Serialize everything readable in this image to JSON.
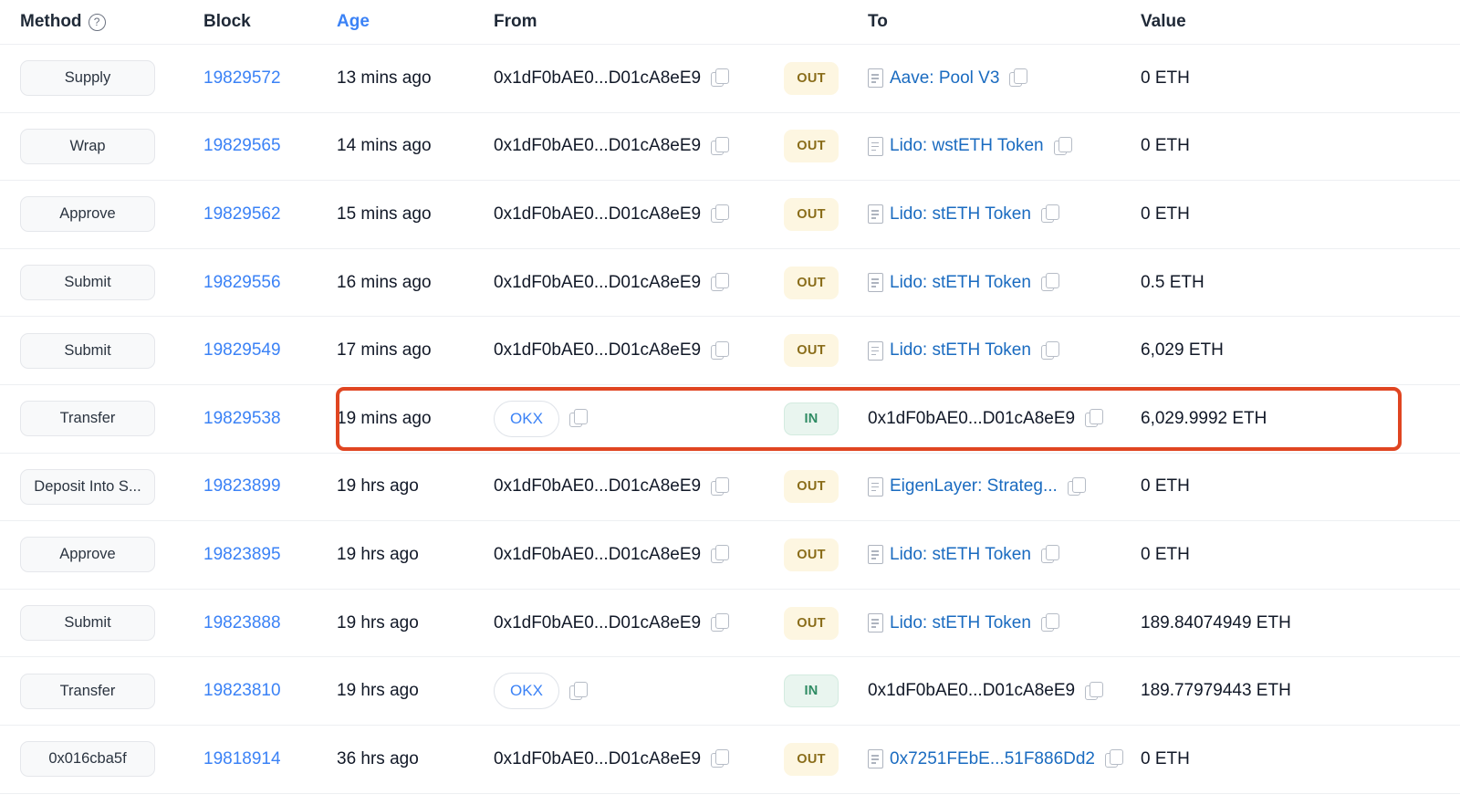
{
  "table": {
    "columns": [
      {
        "key": "method",
        "label": "Method",
        "has_help_icon": true,
        "sortable": false
      },
      {
        "key": "block",
        "label": "Block",
        "has_help_icon": false,
        "sortable": false
      },
      {
        "key": "age",
        "label": "Age",
        "has_help_icon": false,
        "sortable": true
      },
      {
        "key": "from",
        "label": "From",
        "has_help_icon": false,
        "sortable": false
      },
      {
        "key": "to",
        "label": "To",
        "has_help_icon": false,
        "sortable": false
      },
      {
        "key": "value",
        "label": "Value",
        "has_help_icon": false,
        "sortable": false
      }
    ],
    "rows": [
      {
        "method": "Supply",
        "block": "19829572",
        "age": "13 mins ago",
        "from": {
          "text": "0x1dF0bAE0...D01cA8eE9",
          "kind": "address",
          "copy": true
        },
        "direction": "OUT",
        "to": {
          "text": "Aave: Pool V3",
          "kind": "contract",
          "copy": true
        },
        "value": "0 ETH"
      },
      {
        "method": "Wrap",
        "block": "19829565",
        "age": "14 mins ago",
        "from": {
          "text": "0x1dF0bAE0...D01cA8eE9",
          "kind": "address",
          "copy": true
        },
        "direction": "OUT",
        "to": {
          "text": "Lido: wstETH Token",
          "kind": "contract",
          "copy": true
        },
        "value": "0 ETH"
      },
      {
        "method": "Approve",
        "block": "19829562",
        "age": "15 mins ago",
        "from": {
          "text": "0x1dF0bAE0...D01cA8eE9",
          "kind": "address",
          "copy": true
        },
        "direction": "OUT",
        "to": {
          "text": "Lido: stETH Token",
          "kind": "contract",
          "copy": true
        },
        "value": "0 ETH"
      },
      {
        "method": "Submit",
        "block": "19829556",
        "age": "16 mins ago",
        "from": {
          "text": "0x1dF0bAE0...D01cA8eE9",
          "kind": "address",
          "copy": true
        },
        "direction": "OUT",
        "to": {
          "text": "Lido: stETH Token",
          "kind": "contract",
          "copy": true
        },
        "value": "0.5 ETH"
      },
      {
        "method": "Submit",
        "block": "19829549",
        "age": "17 mins ago",
        "from": {
          "text": "0x1dF0bAE0...D01cA8eE9",
          "kind": "address",
          "copy": true
        },
        "direction": "OUT",
        "to": {
          "text": "Lido: stETH Token",
          "kind": "contract",
          "copy": true
        },
        "value": "6,029 ETH"
      },
      {
        "method": "Transfer",
        "block": "19829538",
        "age": "19 mins ago",
        "from": {
          "text": "OKX",
          "kind": "entity",
          "copy": true
        },
        "direction": "IN",
        "to": {
          "text": "0x1dF0bAE0...D01cA8eE9",
          "kind": "address",
          "copy": true
        },
        "value": "6,029.9992 ETH",
        "highlighted": true
      },
      {
        "method": "Deposit Into S...",
        "block": "19823899",
        "age": "19 hrs ago",
        "from": {
          "text": "0x1dF0bAE0...D01cA8eE9",
          "kind": "address",
          "copy": true
        },
        "direction": "OUT",
        "to": {
          "text": "EigenLayer: Strateg...",
          "kind": "contract",
          "copy": true
        },
        "value": "0 ETH"
      },
      {
        "method": "Approve",
        "block": "19823895",
        "age": "19 hrs ago",
        "from": {
          "text": "0x1dF0bAE0...D01cA8eE9",
          "kind": "address",
          "copy": true
        },
        "direction": "OUT",
        "to": {
          "text": "Lido: stETH Token",
          "kind": "contract",
          "copy": true
        },
        "value": "0 ETH"
      },
      {
        "method": "Submit",
        "block": "19823888",
        "age": "19 hrs ago",
        "from": {
          "text": "0x1dF0bAE0...D01cA8eE9",
          "kind": "address",
          "copy": true
        },
        "direction": "OUT",
        "to": {
          "text": "Lido: stETH Token",
          "kind": "contract",
          "copy": true
        },
        "value": "189.84074949 ETH"
      },
      {
        "method": "Transfer",
        "block": "19823810",
        "age": "19 hrs ago",
        "from": {
          "text": "OKX",
          "kind": "entity",
          "copy": true
        },
        "direction": "IN",
        "to": {
          "text": "0x1dF0bAE0...D01cA8eE9",
          "kind": "address",
          "copy": true
        },
        "value": "189.77979443 ETH"
      },
      {
        "method": "0x016cba5f",
        "block": "19818914",
        "age": "36 hrs ago",
        "from": {
          "text": "0x1dF0bAE0...D01cA8eE9",
          "kind": "address",
          "copy": true
        },
        "direction": "OUT",
        "to": {
          "text": "0x7251FEbE...51F886Dd2",
          "kind": "contract",
          "copy": true
        },
        "value": "0 ETH"
      }
    ]
  },
  "icons": {
    "help": "?",
    "copy": "copy-icon",
    "contract": "document-icon"
  },
  "colors": {
    "link": "#3b82f6",
    "contract_link": "#1a6bc0",
    "badge_out_bg": "#fdf6e1",
    "badge_out_fg": "#8a6d1a",
    "badge_in_bg": "#e9f5ef",
    "badge_in_fg": "#2e8b63",
    "highlight": "#e04521",
    "row_divider": "#edeff2",
    "method_bg": "#f8f9fa"
  }
}
